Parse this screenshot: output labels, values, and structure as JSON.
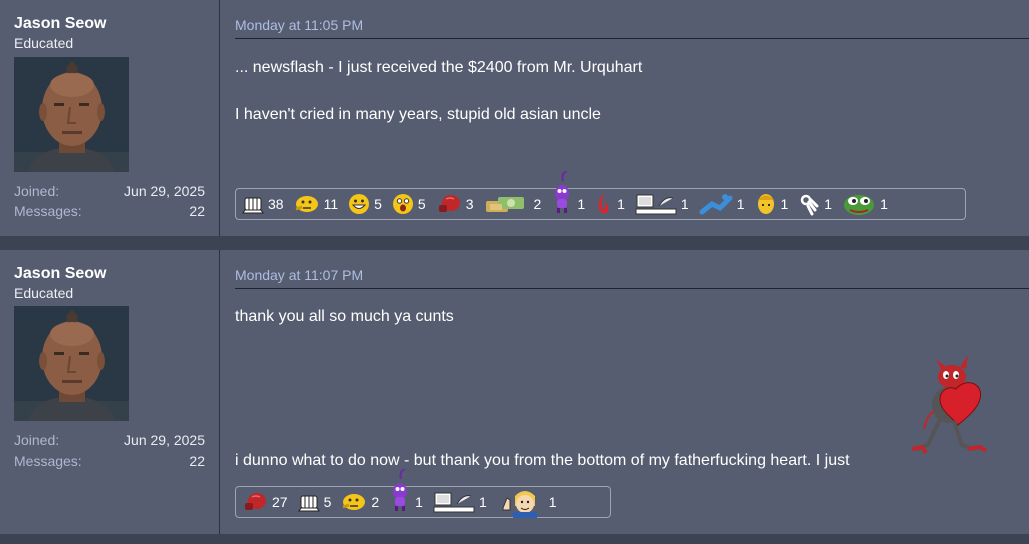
{
  "colors": {
    "post_bg": "#565d70",
    "separator": "#3c4352",
    "date": "#aebde0",
    "stat_label": "#aeb8d2"
  },
  "posts": [
    {
      "author": {
        "name": "Jason Seow",
        "title": "Educated",
        "joined_label": "Joined:",
        "joined": "Jun 29, 2025",
        "messages_label": "Messages:",
        "messages": "22"
      },
      "date": "Monday at 11:05 PM",
      "lines": [
        "... newsflash - I just received the $2400 from Mr. Urquhart",
        "I haven't cried in many years, stupid old asian uncle"
      ],
      "reactions": [
        {
          "icon": "fist-bump-icon",
          "count": "38"
        },
        {
          "icon": "thinking-face-icon",
          "count": "11"
        },
        {
          "icon": "grinning-face-icon",
          "count": "5"
        },
        {
          "icon": "shocked-face-icon",
          "count": "5"
        },
        {
          "icon": "boxing-glove-icon",
          "count": "3"
        },
        {
          "icon": "money-stack-icon",
          "count": "2"
        },
        {
          "icon": "purple-imp-icon",
          "count": "1"
        },
        {
          "icon": "red-flame-icon",
          "count": "1"
        },
        {
          "icon": "computer-desk-icon",
          "count": "1"
        },
        {
          "icon": "blue-figure-icon",
          "count": "1"
        },
        {
          "icon": "yellow-head-icon",
          "count": "1"
        },
        {
          "icon": "ok-hand-icon",
          "count": "1"
        },
        {
          "icon": "pepe-frog-icon",
          "count": "1"
        }
      ]
    },
    {
      "author": {
        "name": "Jason Seow",
        "title": "Educated",
        "joined_label": "Joined:",
        "joined": "Jun 29, 2025",
        "messages_label": "Messages:",
        "messages": "22"
      },
      "date": "Monday at 11:07 PM",
      "lines": [
        "thank you all so much ya cunts",
        "i dunno what to do now - but thank you from the bottom of my fatherfucking heart. I just"
      ],
      "inline_image": "devil-holding-heart-icon",
      "reactions": [
        {
          "icon": "boxing-glove-icon",
          "count": "27"
        },
        {
          "icon": "fist-bump-icon",
          "count": "5"
        },
        {
          "icon": "thinking-face-icon",
          "count": "2"
        },
        {
          "icon": "purple-imp-icon",
          "count": "1"
        },
        {
          "icon": "computer-desk-icon",
          "count": "1"
        },
        {
          "icon": "vault-boy-thumbs-up-icon",
          "count": "1"
        }
      ]
    }
  ]
}
